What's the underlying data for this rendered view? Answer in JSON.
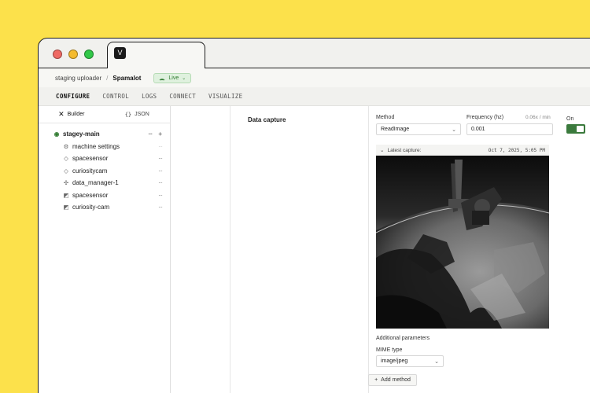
{
  "window": {
    "tab_logo": "V"
  },
  "breadcrumb": {
    "org": "staging uploader",
    "separator": "/",
    "machine": "Spamalot",
    "status": "Live",
    "status_color": "#2f7a2f"
  },
  "navtabs": [
    "CONFIGURE",
    "CONTROL",
    "LOGS",
    "CONNECT",
    "VISUALIZE"
  ],
  "sidebar": {
    "view_builder": "Builder",
    "view_json": "JSON",
    "root": {
      "label": "stagey-main",
      "more": "···",
      "add": "+"
    },
    "items": [
      {
        "label": "machine settings",
        "icon": "gear-icon",
        "glyph": "⚙",
        "more": "···"
      },
      {
        "label": "spacesensor",
        "icon": "diamond-icon",
        "glyph": "◇",
        "more": "···"
      },
      {
        "label": "curiositycam",
        "icon": "diamond-icon",
        "glyph": "◇",
        "more": "···"
      },
      {
        "label": "data_manager-1",
        "icon": "sparkle-icon",
        "glyph": "✣",
        "more": "···"
      },
      {
        "label": "spacesensor",
        "icon": "module-icon",
        "glyph": "◩",
        "more": "···"
      },
      {
        "label": "curiosity-cam",
        "icon": "module-icon",
        "glyph": "◩",
        "more": "···"
      }
    ]
  },
  "data_capture": {
    "title": "Data capture",
    "method_label": "Method",
    "method_value": "ReadImage",
    "frequency_label": "Frequency (hz)",
    "frequency_rate": "0.06x / min",
    "frequency_value": "0.001",
    "on_label": "On",
    "toggle_on": true,
    "latest_capture_label": "Latest capture:",
    "latest_capture_time": "Oct 7, 2025, 5:05 PM",
    "additional_parameters_label": "Additional parameters",
    "mime_type_label": "MIME type",
    "mime_type_value": "image/jpeg",
    "add_method_label": "Add method",
    "add_method_glyph": "+",
    "accent_color": "#3b7a3d"
  }
}
